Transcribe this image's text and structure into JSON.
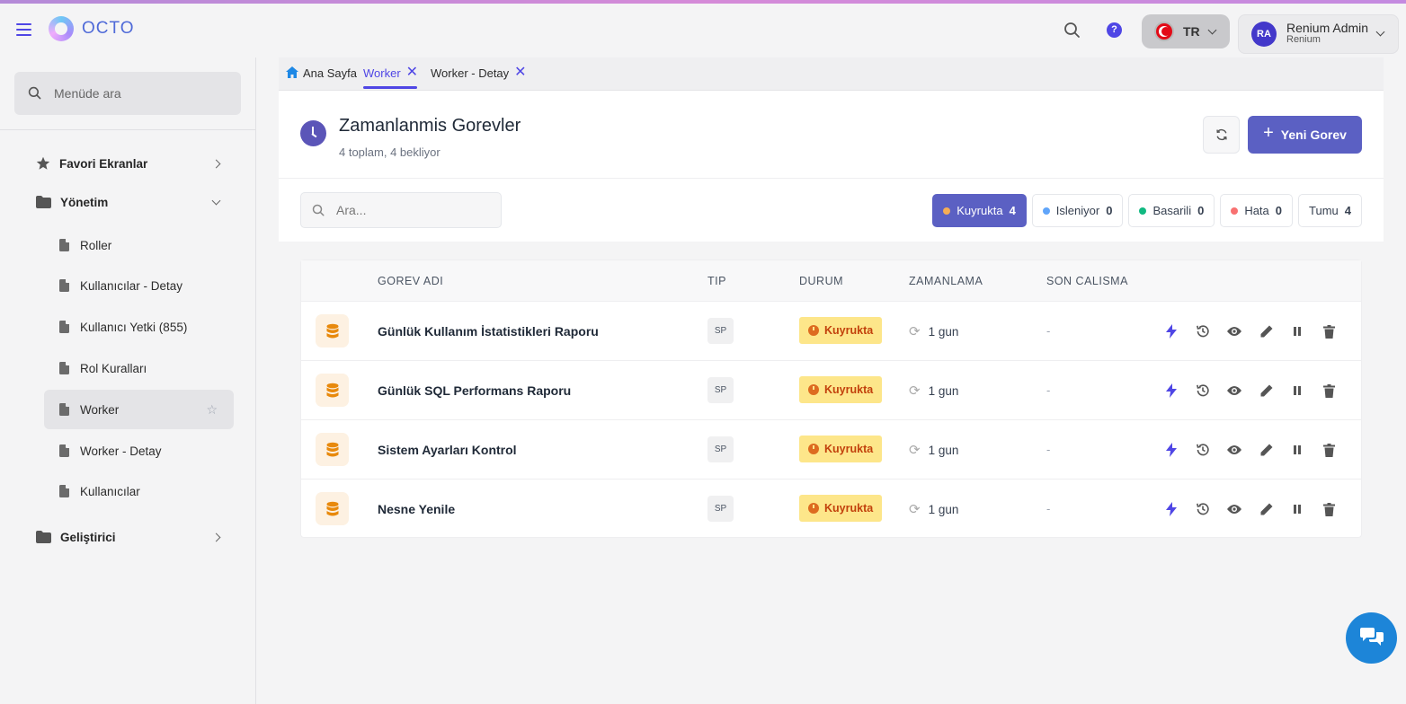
{
  "app": {
    "name": "OCTO"
  },
  "topbar": {
    "help_label": "?",
    "language": {
      "code": "TR"
    },
    "user": {
      "initials": "RA",
      "name": "Renium Admin",
      "org": "Renium"
    }
  },
  "sidebar": {
    "search_placeholder": "Menüde ara",
    "groups": {
      "favorites": "Favori Ekranlar",
      "management": "Yönetim",
      "developer": "Geliştirici"
    },
    "items": [
      {
        "label": "Roller"
      },
      {
        "label": "Kullanıcılar - Detay"
      },
      {
        "label": "Kullanıcı Yetki (855)"
      },
      {
        "label": "Rol Kuralları"
      },
      {
        "label": "Worker"
      },
      {
        "label": "Worker - Detay"
      },
      {
        "label": "Kullanıcılar"
      }
    ]
  },
  "tabs": [
    {
      "label": "Ana Sayfa"
    },
    {
      "label": "Worker"
    },
    {
      "label": "Worker - Detay"
    }
  ],
  "page": {
    "title": "Zamanlanmis Gorevler",
    "subtitle": "4 toplam, 4 bekliyor",
    "new_button": "Yeni Gorev",
    "search_placeholder": "Ara..."
  },
  "filters": [
    {
      "label": "Kuyrukta",
      "count": "4",
      "color": "#f6ad55"
    },
    {
      "label": "Isleniyor",
      "count": "0",
      "color": "#60a5fa"
    },
    {
      "label": "Basarili",
      "count": "0",
      "color": "#10b981"
    },
    {
      "label": "Hata",
      "count": "0",
      "color": "#f87171"
    },
    {
      "label": "Tumu",
      "count": "4"
    }
  ],
  "table": {
    "columns": {
      "name": "GOREV ADI",
      "type": "TIP",
      "status": "DURUM",
      "schedule": "ZAMANLAMA",
      "last_run": "SON CALISMA"
    },
    "rows": [
      {
        "name": "Günlük Kullanım İstatistikleri Raporu",
        "type": "SP",
        "status": "Kuyrukta",
        "schedule": "1 gun",
        "last_run": "-"
      },
      {
        "name": "Günlük SQL Performans Raporu",
        "type": "SP",
        "status": "Kuyrukta",
        "schedule": "1 gun",
        "last_run": "-"
      },
      {
        "name": "Sistem Ayarları Kontrol",
        "type": "SP",
        "status": "Kuyrukta",
        "schedule": "1 gun",
        "last_run": "-"
      },
      {
        "name": "Nesne Yenile",
        "type": "SP",
        "status": "Kuyrukta",
        "schedule": "1 gun",
        "last_run": "-"
      }
    ]
  },
  "colors": {
    "accent": "#5b60c3",
    "brand": "#4f46e5",
    "status_queued_bg": "#fde68a",
    "fab": "#1d85d8"
  }
}
